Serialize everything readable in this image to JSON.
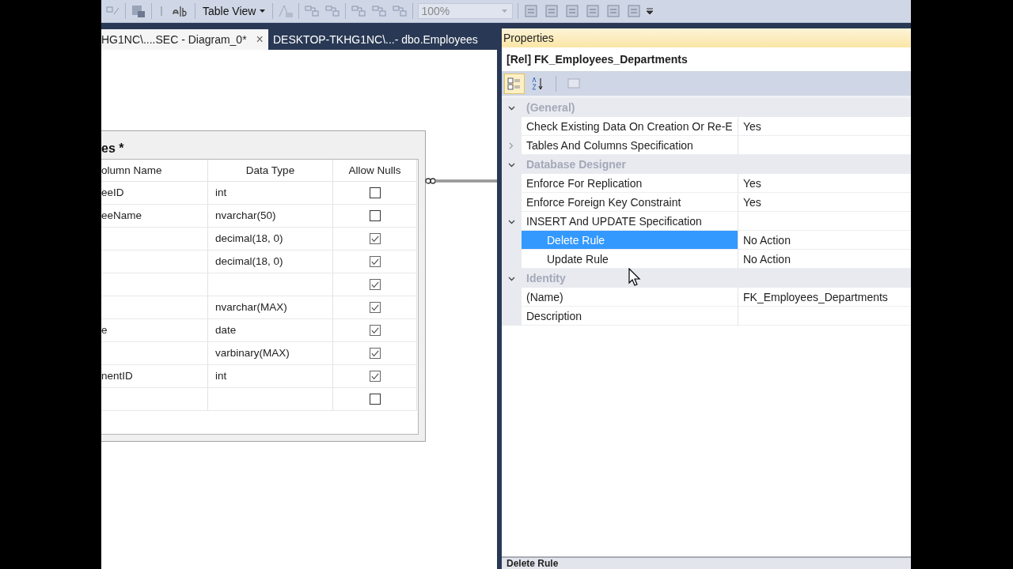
{
  "toolbar": {
    "view_button": "Table View",
    "zoom": "100%"
  },
  "tabs": [
    {
      "label": "HG1NC\\....SEC - Diagram_0*",
      "selected": true,
      "close": "×"
    },
    {
      "label": "DESKTOP-TKHG1NC\\...- dbo.Employees",
      "selected": false
    }
  ],
  "table": {
    "title": "es *",
    "columns": [
      "olumn Name",
      "Data Type",
      "Allow Nulls"
    ],
    "rows": [
      {
        "name": "eeID",
        "type": "int",
        "allow_nulls": false
      },
      {
        "name": "eeName",
        "type": "nvarchar(50)",
        "allow_nulls": false
      },
      {
        "type": "decimal(18, 0)",
        "allow_nulls": true
      },
      {
        "type": "decimal(18, 0)",
        "allow_nulls": true
      },
      {
        "allow_nulls": true
      },
      {
        "type": "nvarchar(MAX)",
        "allow_nulls": true
      },
      {
        "name": "e",
        "type": "date",
        "allow_nulls": true
      },
      {
        "type": "varbinary(MAX)",
        "allow_nulls": true
      },
      {
        "name": "nentID",
        "type": "int",
        "allow_nulls": true
      },
      {
        "allow_nulls": false
      }
    ]
  },
  "properties": {
    "title": "Properties",
    "object": "[Rel] FK_Employees_Departments",
    "view_buttons": [
      {
        "kind": "categorized",
        "selected": true
      },
      {
        "kind": "alphabetical",
        "selected": false
      },
      {
        "kind": "pages",
        "selected": false
      }
    ],
    "rows": [
      {
        "kind": "category",
        "name": "(General)",
        "expanded": true,
        "children": [
          {
            "kind": "property",
            "name": "Check Existing Data On Creation Or Re-E",
            "value": "Yes",
            "selected": false
          },
          {
            "kind": "property",
            "name": "Tables And Columns Specification",
            "expanded": false,
            "selected": false
          }
        ]
      },
      {
        "kind": "category",
        "name": "Database Designer",
        "expanded": true,
        "children": [
          {
            "kind": "property",
            "name": "Enforce For Replication",
            "value": "Yes",
            "selected": false
          },
          {
            "kind": "property",
            "name": "Enforce Foreign Key Constraint",
            "value": "Yes",
            "selected": false
          },
          {
            "kind": "property",
            "name": "INSERT And UPDATE Specification",
            "expanded": true,
            "selected": false,
            "children": [
              {
                "kind": "property",
                "name": "Delete Rule",
                "value": "No Action",
                "selected": true
              },
              {
                "kind": "property",
                "name": "Update Rule",
                "value": "No Action",
                "selected": false
              }
            ]
          }
        ]
      },
      {
        "kind": "category",
        "name": "Identity",
        "expanded": true,
        "children": [
          {
            "kind": "property",
            "name": "(Name)",
            "value": "FK_Employees_Departments",
            "selected": false
          },
          {
            "kind": "property",
            "name": "Description",
            "selected": false
          }
        ]
      }
    ],
    "description": "Delete Rule"
  }
}
